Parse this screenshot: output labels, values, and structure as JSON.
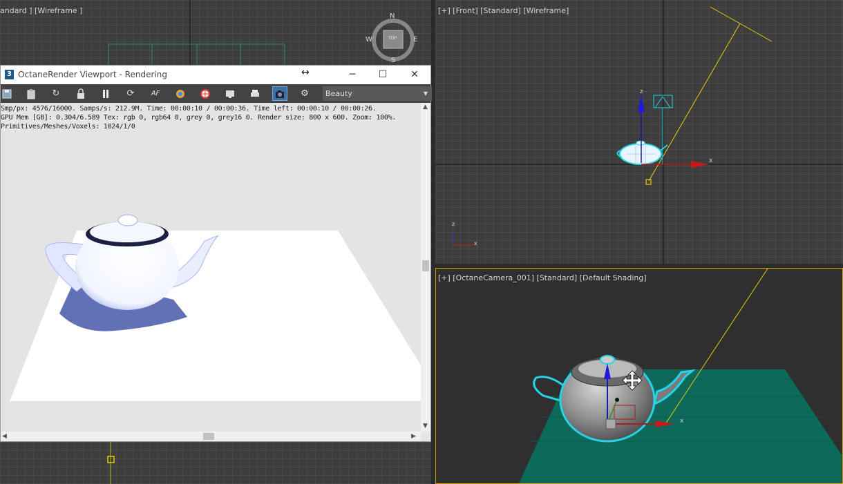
{
  "viewports": {
    "top_left_label": "andard ] [Wireframe ]",
    "front_label": "[+] [Front] [Standard] [Wireframe]",
    "camera_label": "[+] [OctaneCamera_001] [Standard] [Default Shading]",
    "viewcube": {
      "n": "N",
      "s": "S",
      "e": "E",
      "w": "W",
      "top": "TOP"
    },
    "axis_x": "x",
    "axis_z": "z"
  },
  "render_window": {
    "app_icon": "3",
    "title": "OctaneRender Viewport - Rendering",
    "controls": {
      "minimize": "─",
      "maximize": "☐",
      "close": "✕"
    },
    "move_cursor": "↔",
    "toolbar": {
      "icons": [
        "save-icon",
        "clipboard-icon",
        "restart-icon",
        "lock-icon",
        "pause-icon",
        "refresh-icon",
        "af-icon",
        "color-picker-icon",
        "render-region-icon",
        "display-icon",
        "print-icon",
        "camera-icon",
        "settings-icon"
      ],
      "af_text": "AF",
      "pass_select": "Beauty"
    },
    "stats": {
      "line1": "Smp/px: 4576/16000.   Samps/s: 212.9M.   Time: 00:00:10 / 00:00:36.   Time left: 00:00:10 / 00:00:26.",
      "line2": "GPU Mem [GB]: 0.304/6.589   Tex: rgb 0, rgb64 0, grey 0, grey16 0.   Render size: 800 x 600.   Zoom: 100%.",
      "line3": "Primitives/Meshes/Voxels: 1024/1/0"
    }
  }
}
